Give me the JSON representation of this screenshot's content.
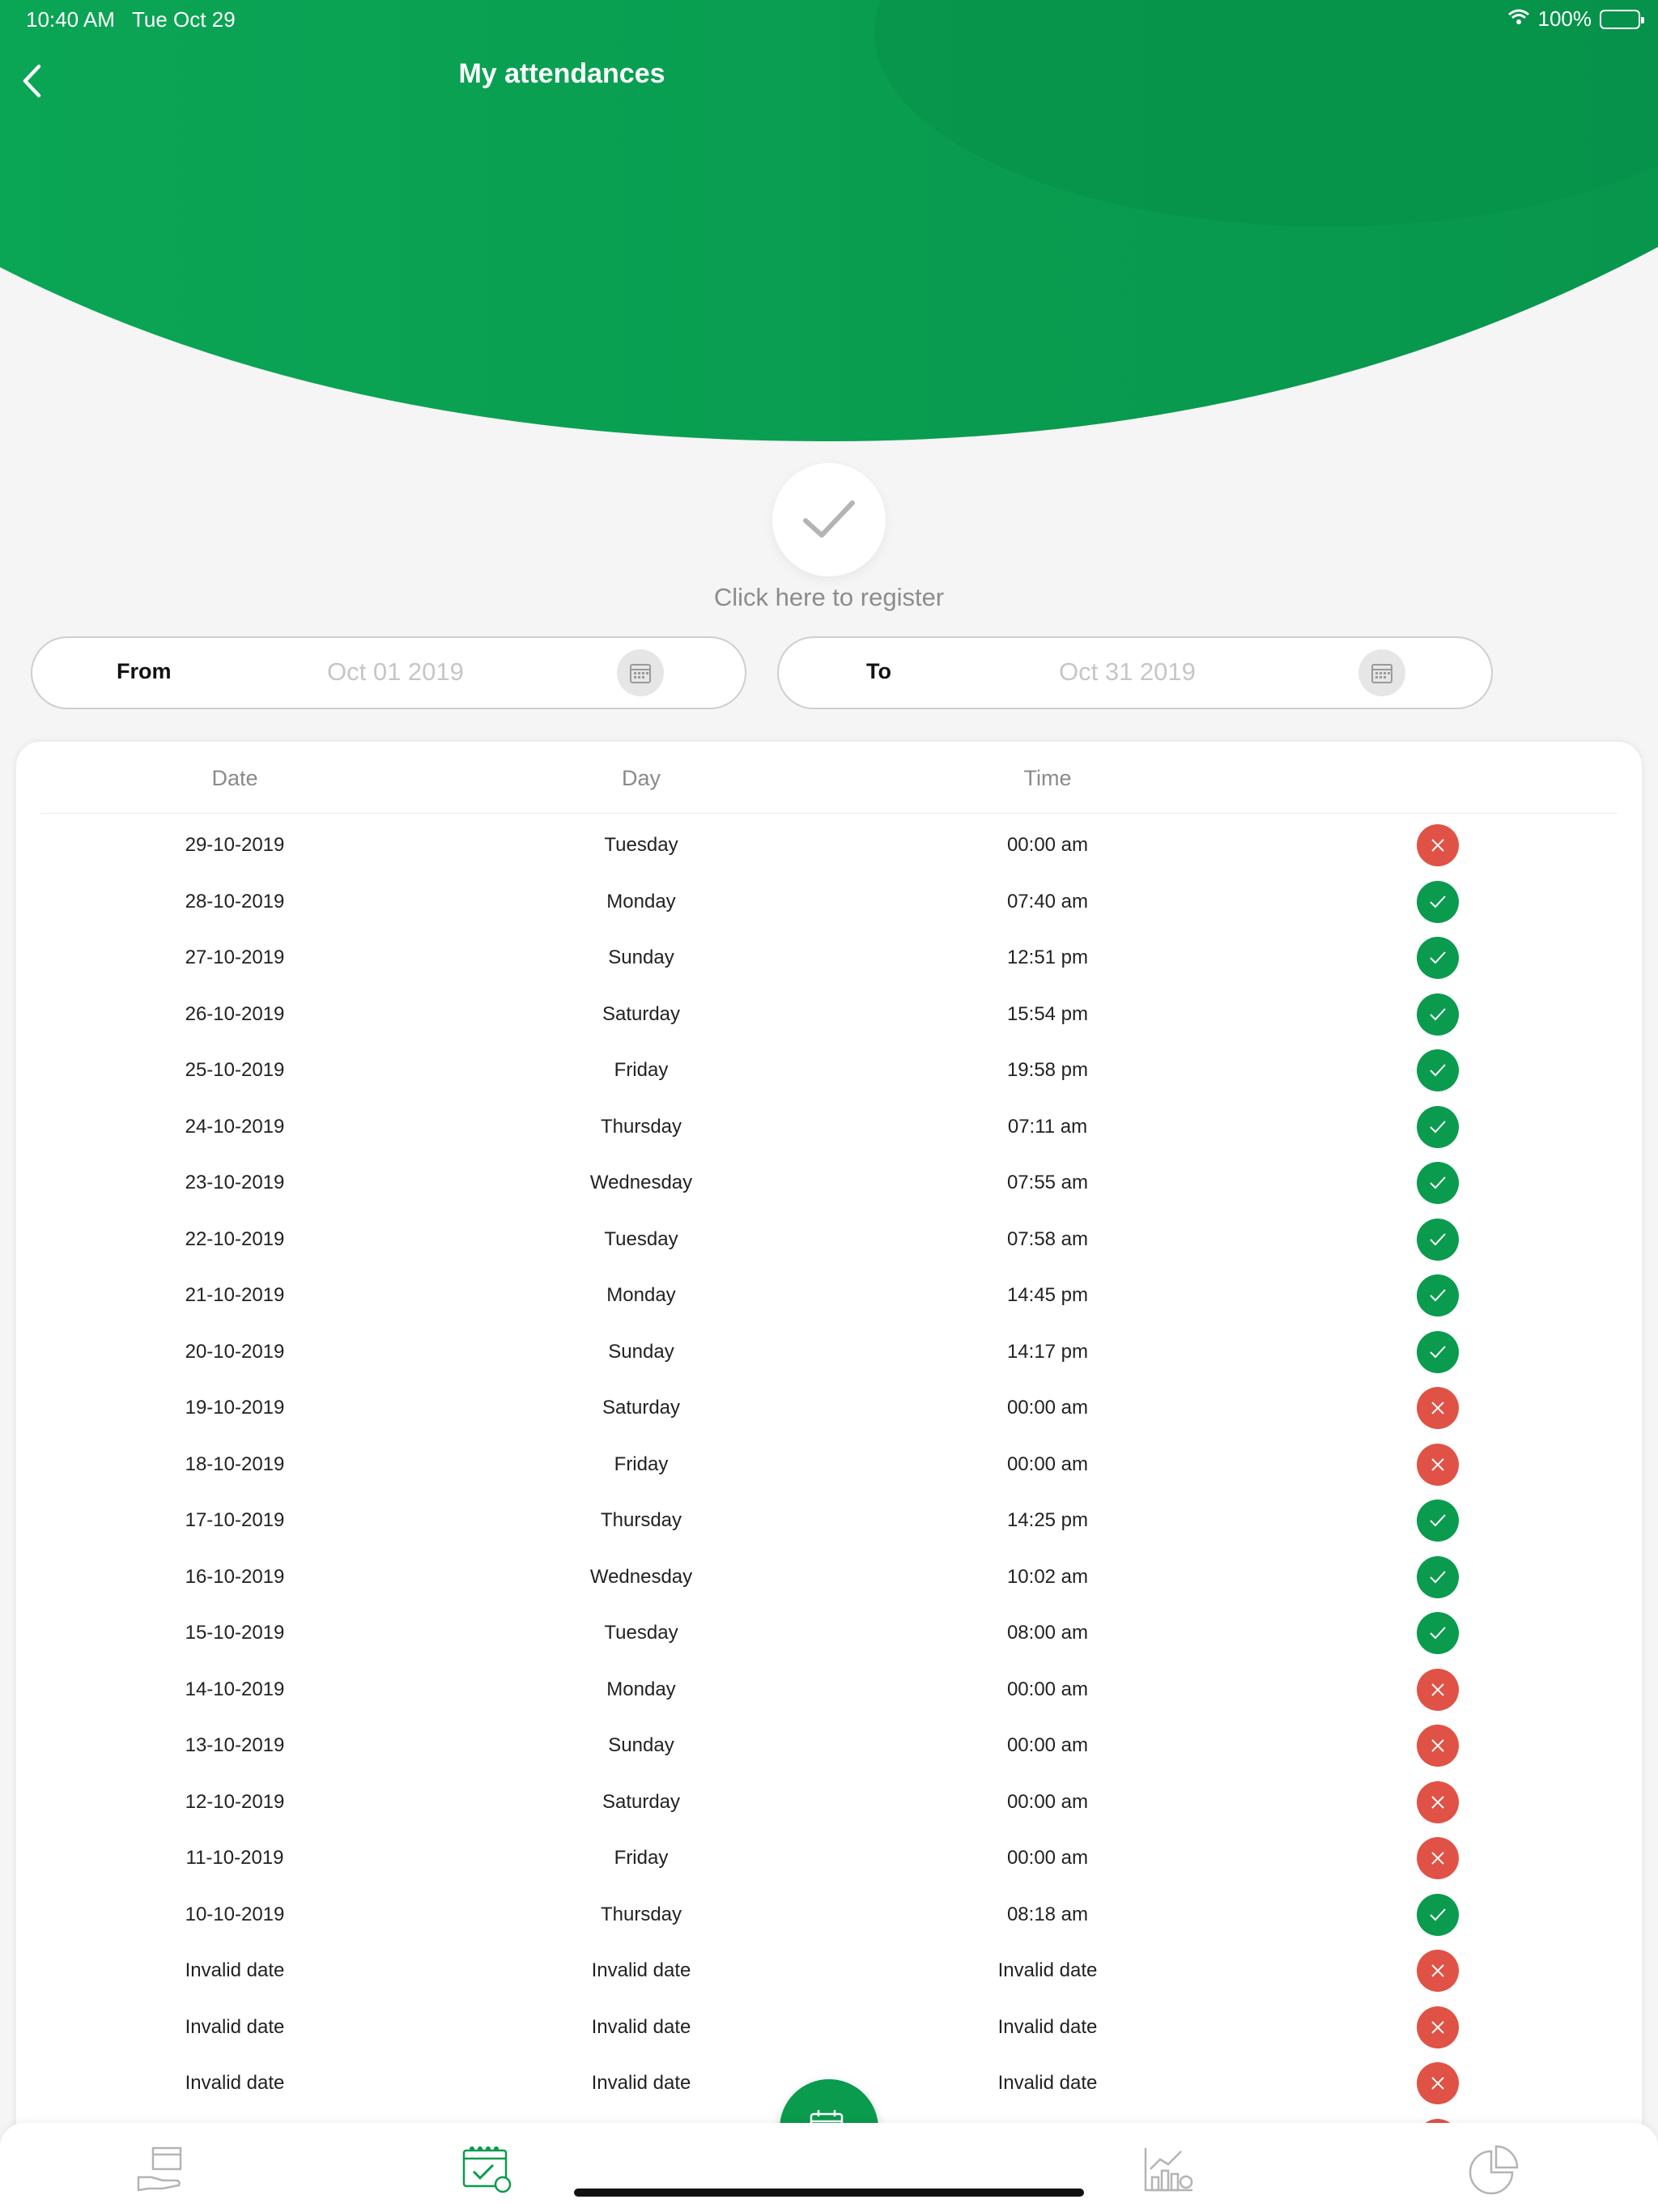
{
  "status_bar": {
    "time": "10:40 AM",
    "date": "Tue Oct 29",
    "battery": "100%"
  },
  "header": {
    "title": "My attendances"
  },
  "register": {
    "label": "Click here to register"
  },
  "filters": {
    "from": {
      "label": "From",
      "value": "Oct 01 2019"
    },
    "to": {
      "label": "To",
      "value": "Oct 31 2019"
    }
  },
  "table": {
    "headers": {
      "date": "Date",
      "day": "Day",
      "time": "Time"
    },
    "rows": [
      {
        "date": "29-10-2019",
        "day": "Tuesday",
        "time": "00:00 am",
        "status": "absent"
      },
      {
        "date": "28-10-2019",
        "day": "Monday",
        "time": "07:40 am",
        "status": "present"
      },
      {
        "date": "27-10-2019",
        "day": "Sunday",
        "time": "12:51 pm",
        "status": "present"
      },
      {
        "date": "26-10-2019",
        "day": "Saturday",
        "time": "15:54 pm",
        "status": "present"
      },
      {
        "date": "25-10-2019",
        "day": "Friday",
        "time": "19:58 pm",
        "status": "present"
      },
      {
        "date": "24-10-2019",
        "day": "Thursday",
        "time": "07:11 am",
        "status": "present"
      },
      {
        "date": "23-10-2019",
        "day": "Wednesday",
        "time": "07:55 am",
        "status": "present"
      },
      {
        "date": "22-10-2019",
        "day": "Tuesday",
        "time": "07:58 am",
        "status": "present"
      },
      {
        "date": "21-10-2019",
        "day": "Monday",
        "time": "14:45 pm",
        "status": "present"
      },
      {
        "date": "20-10-2019",
        "day": "Sunday",
        "time": "14:17 pm",
        "status": "present"
      },
      {
        "date": "19-10-2019",
        "day": "Saturday",
        "time": "00:00 am",
        "status": "absent"
      },
      {
        "date": "18-10-2019",
        "day": "Friday",
        "time": "00:00 am",
        "status": "absent"
      },
      {
        "date": "17-10-2019",
        "day": "Thursday",
        "time": "14:25 pm",
        "status": "present"
      },
      {
        "date": "16-10-2019",
        "day": "Wednesday",
        "time": "10:02 am",
        "status": "present"
      },
      {
        "date": "15-10-2019",
        "day": "Tuesday",
        "time": "08:00 am",
        "status": "present"
      },
      {
        "date": "14-10-2019",
        "day": "Monday",
        "time": "00:00 am",
        "status": "absent"
      },
      {
        "date": "13-10-2019",
        "day": "Sunday",
        "time": "00:00 am",
        "status": "absent"
      },
      {
        "date": "12-10-2019",
        "day": "Saturday",
        "time": "00:00 am",
        "status": "absent"
      },
      {
        "date": "11-10-2019",
        "day": "Friday",
        "time": "00:00 am",
        "status": "absent"
      },
      {
        "date": "10-10-2019",
        "day": "Thursday",
        "time": "08:18 am",
        "status": "present"
      },
      {
        "date": "Invalid date",
        "day": "Invalid date",
        "time": "Invalid date",
        "status": "absent"
      },
      {
        "date": "Invalid date",
        "day": "Invalid date",
        "time": "Invalid date",
        "status": "absent"
      },
      {
        "date": "Invalid date",
        "day": "Invalid date",
        "time": "Invalid date",
        "status": "absent"
      },
      {
        "date": "",
        "day": "",
        "time": "",
        "status": "absent"
      }
    ]
  },
  "tabs": [
    {
      "icon": "hand-box-icon"
    },
    {
      "icon": "calendar-check-icon"
    },
    {
      "icon": "calendar-icon"
    },
    {
      "icon": "bar-chart-icon"
    },
    {
      "icon": "pie-chart-icon"
    }
  ],
  "colors": {
    "brand_green": "#0a9b4e",
    "status_absent": "#e05245",
    "status_present": "#0a9b4e"
  }
}
